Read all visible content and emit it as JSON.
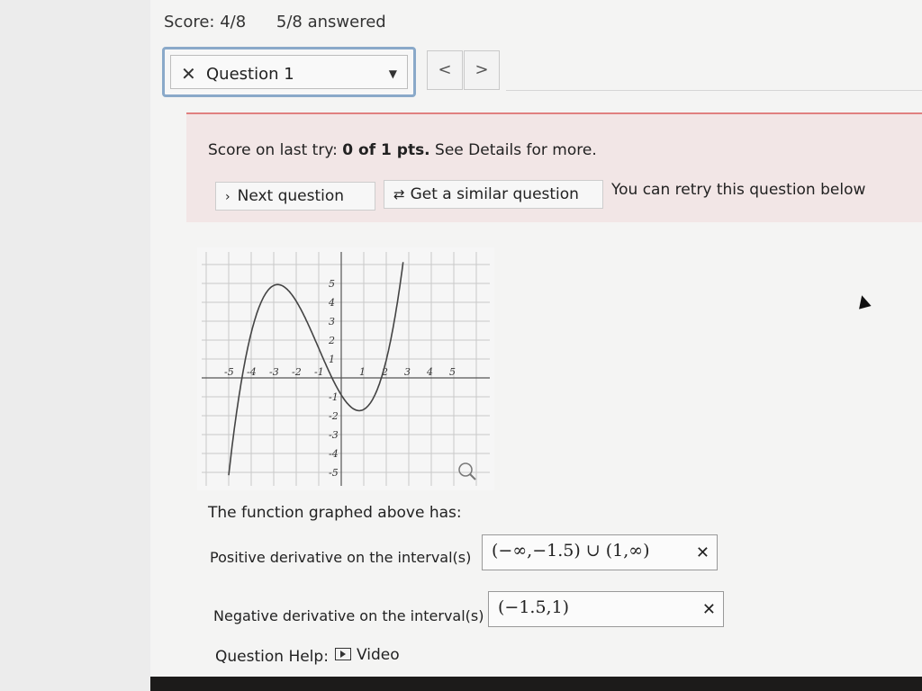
{
  "header": {
    "score": "Score: 4/8",
    "answered": "5/8 answered"
  },
  "question_selector": {
    "mark": "✕",
    "label": "Question 1",
    "caret": "▼"
  },
  "nav": {
    "prev": "<",
    "next": ">"
  },
  "feedback": {
    "score_prefix": "Score on last try: ",
    "score_value": "0 of 1 pts.",
    "score_suffix": " See Details for more.",
    "next_question": "Next question",
    "similar_question": "Get a similar question",
    "retry_text": "You can retry this question below"
  },
  "graph": {
    "x_ticks": [
      "-5",
      "-4",
      "-3",
      "-2",
      "-1",
      "1",
      "2",
      "3",
      "4",
      "5"
    ],
    "y_ticks_pos": [
      "5",
      "4",
      "3",
      "2",
      "1"
    ],
    "y_ticks_neg": [
      "-1",
      "-2",
      "-3",
      "-4",
      "-5"
    ],
    "zoom_icon": "magnifier-icon"
  },
  "question": {
    "prompt": "The function graphed above has:",
    "positive_label": "Positive derivative on the interval(s)",
    "positive_answer": "(−∞,−1.5) ∪ (1,∞)",
    "negative_label": "Negative derivative on the interval(s)",
    "negative_answer": "(−1.5,1)",
    "wrong_mark": "✕"
  },
  "help": {
    "label": "Question Help:",
    "video": "Video"
  }
}
